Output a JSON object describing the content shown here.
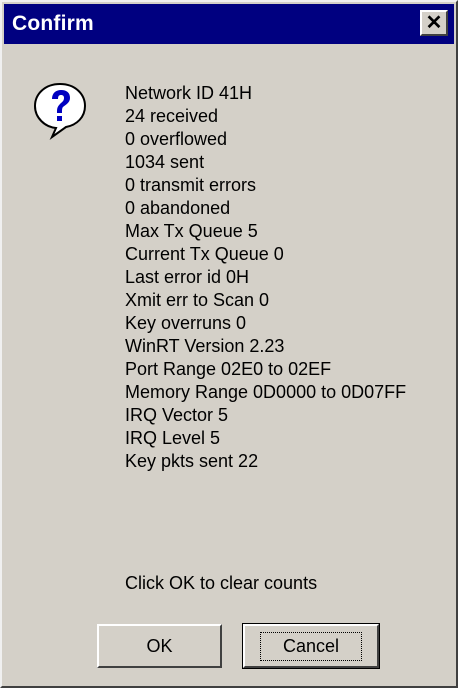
{
  "window": {
    "title": "Confirm",
    "close_label": "✕"
  },
  "icon": "question-mark-icon",
  "message_lines": [
    "Network ID 41H",
    "24 received",
    "0 overflowed",
    "1034 sent",
    "0 transmit errors",
    "0 abandoned",
    "Max Tx Queue 5",
    "Current Tx Queue 0",
    "Last error id 0H",
    "Xmit err to Scan 0",
    "Key overruns 0",
    "WinRT Version 2.23",
    "Port Range 02E0 to 02EF",
    "Memory Range 0D0000 to 0D07FF",
    "IRQ Vector 5",
    "IRQ Level 5",
    "Key pkts sent 22"
  ],
  "prompt": "Click OK to clear counts",
  "buttons": {
    "ok_label": "OK",
    "cancel_label": "Cancel"
  },
  "colors": {
    "titlebar": "#000080",
    "dialog_bg": "#d4d0c8"
  }
}
